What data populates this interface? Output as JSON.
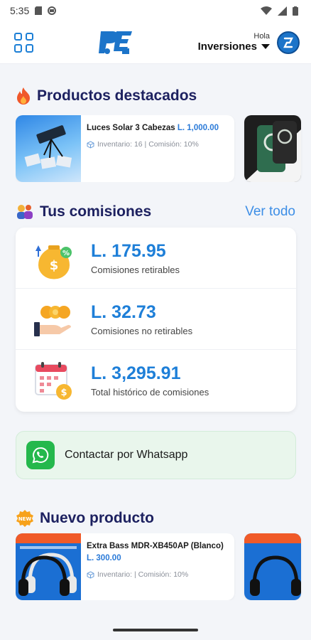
{
  "status_bar": {
    "time": "5:35"
  },
  "header": {
    "greeting": "Hola",
    "account": "Inversiones"
  },
  "featured": {
    "title": "Productos destacados",
    "products": [
      {
        "name": "Luces Solar 3 Cabezas",
        "price": "L. 1,000.00",
        "meta": "Inventario: 16 | Comisión: 10%"
      }
    ]
  },
  "commissions": {
    "title": "Tus comisiones",
    "see_all": "Ver todo",
    "items": [
      {
        "amount": "L. 175.95",
        "label": "Comisiones retirables"
      },
      {
        "amount": "L. 32.73",
        "label": "Comisiones no retirables"
      },
      {
        "amount": "L. 3,295.91",
        "label": "Total histórico de comisiones"
      }
    ]
  },
  "whatsapp": {
    "label": "Contactar por Whatsapp"
  },
  "new_product": {
    "title": "Nuevo producto",
    "products": [
      {
        "name": "Extra Bass MDR-XB450AP (Blanco)",
        "price": "L. 300.00",
        "meta": "Inventario: | Comisión: 10%"
      }
    ]
  }
}
